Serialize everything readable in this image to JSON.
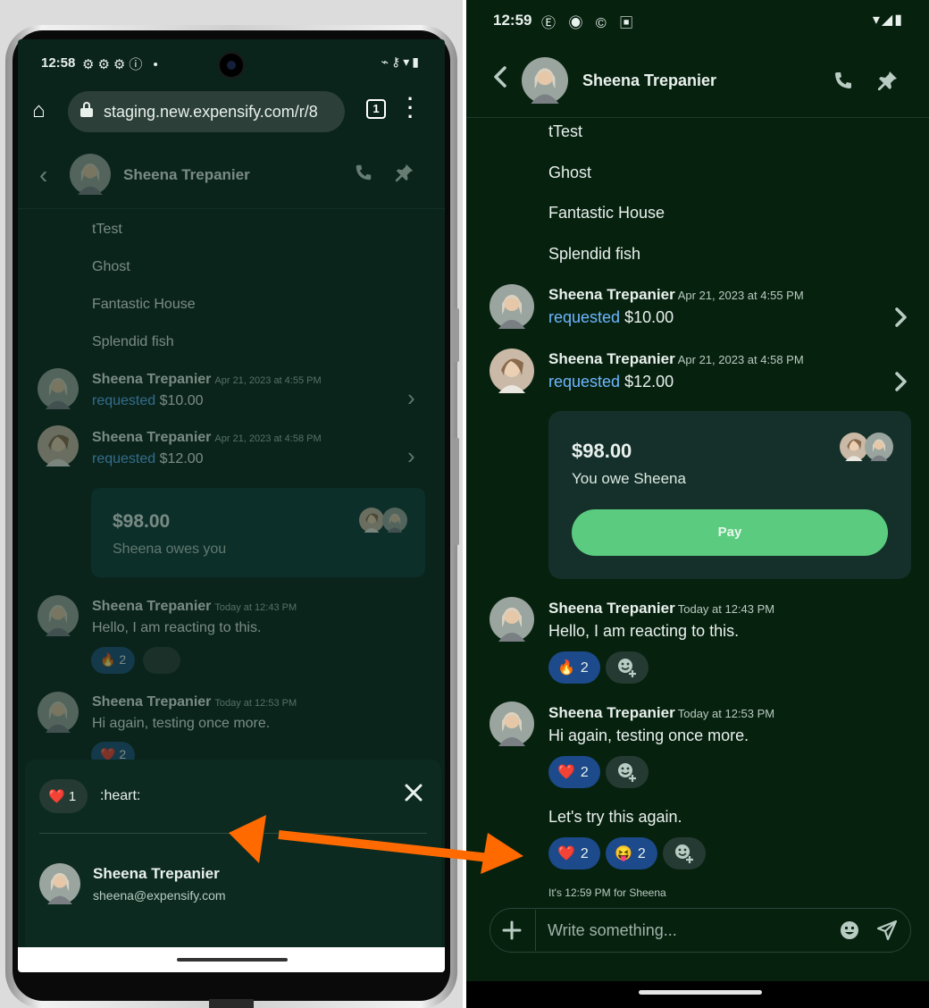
{
  "left": {
    "status": {
      "time": "12:58",
      "icons_left": "⚙⚙⚙ⓘ •",
      "icons_right": "⌁⚷▾▮"
    },
    "browser": {
      "url": "staging.new.expensify.com/r/8",
      "tabs_count": "1"
    },
    "header": {
      "name": "Sheena Trepanier"
    },
    "items": [
      "tTest",
      "Ghost",
      "Fantastic House",
      "Splendid fish"
    ],
    "requests": [
      {
        "name": "Sheena Trepanier",
        "time": "Apr 21, 2023 at 4:55 PM",
        "action": "requested",
        "amount": "$10.00"
      },
      {
        "name": "Sheena Trepanier",
        "time": "Apr 21, 2023 at 4:58 PM",
        "action": "requested",
        "amount": "$12.00"
      }
    ],
    "card": {
      "amount": "$98.00",
      "description": "Sheena owes you"
    },
    "messages": [
      {
        "name": "Sheena Trepanier",
        "time": "Today at 12:43 PM",
        "text": "Hello, I am reacting to this.",
        "reaction_emoji": "🔥",
        "reaction_count": "2"
      },
      {
        "name": "Sheena Trepanier",
        "time": "Today at 12:53 PM",
        "text": "Hi again, testing once more.",
        "reaction_emoji": "❤️",
        "reaction_count": "2"
      }
    ],
    "sheet": {
      "emoji": "❤️",
      "count": "1",
      "code": ":heart:",
      "user_name": "Sheena Trepanier",
      "user_email": "sheena@expensify.com"
    }
  },
  "right": {
    "status": {
      "time": "12:59",
      "icons_left": "Ⓔ ◉ ©  ▣",
      "icons_right": "▾◢▮"
    },
    "header": {
      "name": "Sheena Trepanier"
    },
    "items": [
      "tTest",
      "Ghost",
      "Fantastic House",
      "Splendid fish"
    ],
    "requests": [
      {
        "name": "Sheena Trepanier",
        "time": "Apr 21, 2023 at 4:55 PM",
        "action": "requested",
        "amount": "$10.00"
      },
      {
        "name": "Sheena Trepanier",
        "time": "Apr 21, 2023 at 4:58 PM",
        "action": "requested",
        "amount": "$12.00"
      }
    ],
    "card": {
      "amount": "$98.00",
      "description": "You owe Sheena",
      "pay_label": "Pay"
    },
    "messages": [
      {
        "name": "Sheena Trepanier",
        "time": "Today at 12:43 PM",
        "text": "Hello, I am reacting to this.",
        "reaction_emoji": "🔥",
        "reaction_count": "2"
      },
      {
        "name": "Sheena Trepanier",
        "time": "Today at 12:53 PM",
        "text": "Hi again, testing once more.",
        "reaction_emoji": "❤️",
        "reaction_count": "2"
      }
    ],
    "followup": {
      "text": "Let's try this again.",
      "reactions": [
        {
          "emoji": "❤️",
          "count": "2"
        },
        {
          "emoji": "😝",
          "count": "2"
        }
      ]
    },
    "local_time_note": "It's 12:59 PM for Sheena",
    "composer": {
      "placeholder": "Write something..."
    }
  },
  "colors": {
    "accent_green": "#5bcc7f",
    "link_blue": "#6db7ff",
    "reaction_blue": "#1c4a8a",
    "arrow_orange": "#ff6a00",
    "app_bg": "#07210f"
  }
}
